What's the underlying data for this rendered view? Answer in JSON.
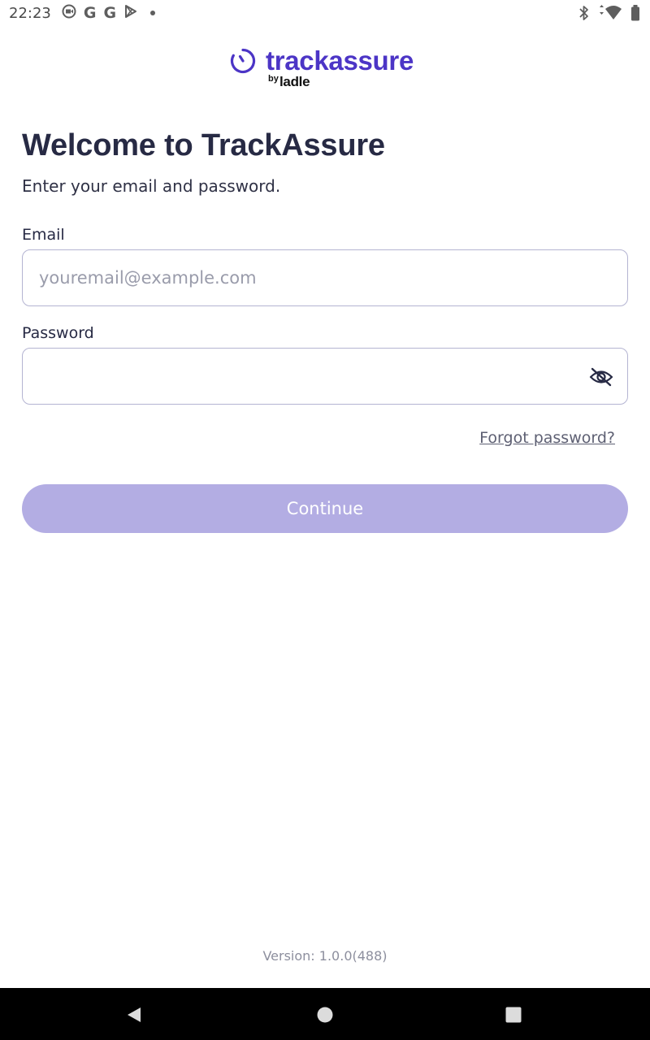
{
  "status_bar": {
    "time": "22:23",
    "notification_icons": [
      "G",
      "G"
    ]
  },
  "brand": {
    "name": "trackassure",
    "by": "by",
    "parent": "ladle",
    "color": "#4c35c6"
  },
  "welcome": {
    "title": "Welcome to TrackAssure",
    "subtitle": "Enter your email and password."
  },
  "form": {
    "email_label": "Email",
    "email_placeholder": "youremail@example.com",
    "email_value": "",
    "password_label": "Password",
    "password_value": "",
    "forgot_password": "Forgot password?",
    "continue_label": "Continue",
    "button_color": "#b3ade3"
  },
  "footer": {
    "version": "Version: 1.0.0(488)"
  },
  "icons": {
    "password_toggle": "eye-off-icon",
    "nav_back": "back-triangle-icon",
    "nav_home": "home-circle-icon",
    "nav_recents": "recents-square-icon"
  }
}
